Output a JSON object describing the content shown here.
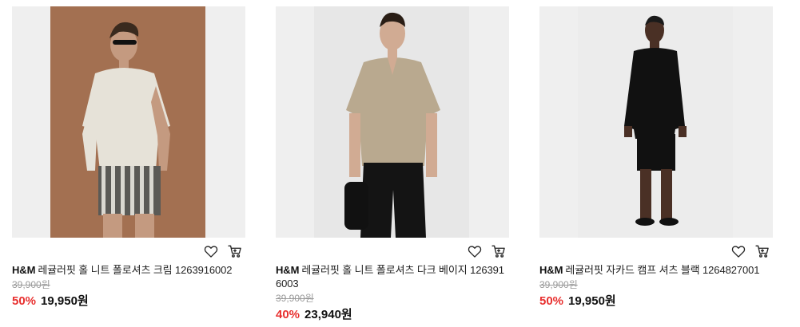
{
  "products": [
    {
      "brand": "H&M",
      "name": "레귤러핏 홀 니트 폴로셔츠 크림 1263916002",
      "original_price": "39,900원",
      "discount": "50%",
      "sale_price": "19,950원",
      "image": {
        "bg": "#9c6a4d",
        "shirt": "#e6e2d8",
        "shorts": "#5b5a56",
        "skin": "#c49a80",
        "hair": "#3a2a1e"
      }
    },
    {
      "brand": "H&M",
      "name": "레귤러핏 홀 니트 폴로셔츠 다크 베이지 126391 6003",
      "original_price": "39,900원",
      "discount": "40%",
      "sale_price": "23,940원",
      "image": {
        "bg": "#e7e7e7",
        "shirt": "#b9a98f",
        "shorts": "#141414",
        "skin": "#d1ab93",
        "hair": "#2a1e16"
      }
    },
    {
      "brand": "H&M",
      "name": "레귤러핏 자카드 캠프 셔츠 블랙 1264827001",
      "original_price": "39,900원",
      "discount": "50%",
      "sale_price": "19,950원",
      "image": {
        "bg": "#ececec",
        "shirt": "#111111",
        "shorts": "#111111",
        "skin": "#4a3025",
        "hair": "#1a1a1a"
      }
    }
  ],
  "icons": {
    "wishlist": "heart-icon",
    "cart": "cart-icon"
  }
}
